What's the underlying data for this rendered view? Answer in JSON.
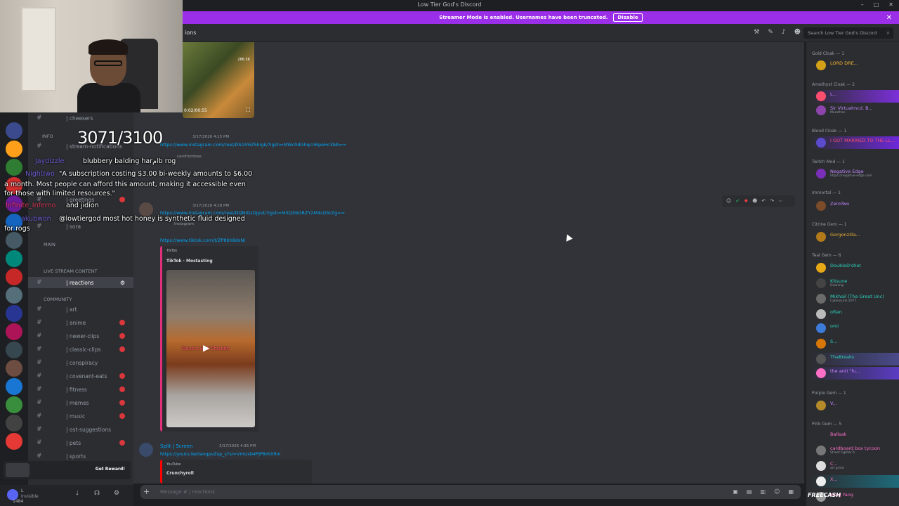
{
  "window": {
    "title": "Low Tier God's Discord"
  },
  "banner": {
    "text": "Streamer Mode is enabled. Usernames have been truncated.",
    "disable_label": "Disable",
    "close": "✕"
  },
  "header": {
    "channel_name": "ions",
    "search_placeholder": "Search Low Tier God's Discord",
    "icons": [
      "hammer-icon",
      "pin-icon",
      "bell-icon",
      "members-icon"
    ]
  },
  "stream_overlay": {
    "counter": "3071/3100",
    "chat": [
      {
        "user": "Jaydizzle",
        "text": "blubbery balding harامb rog"
      },
      {
        "user": "NightIwo",
        "text": "\"A subscription costing $3.00 bi-weekly amounts to $6.00"
      },
      {
        "user": "",
        "text": "a month. Most people can afford this amount, making it accessible even"
      },
      {
        "user": "",
        "text": "for those with limited resources.\""
      },
      {
        "user": "Infinite_Inferno",
        "text": "and jidion"
      },
      {
        "user": "akubwon",
        "text": "@lowtiergod most hot honey is synthetic fluid designed"
      },
      {
        "user": "",
        "text": "for rogs"
      }
    ]
  },
  "sidebar": {
    "channels": [
      {
        "label": "| cheesers",
        "unread": false
      },
      {
        "label": "| stream-notifications",
        "unread": false
      },
      {
        "label": "| greetings",
        "unread": true
      },
      {
        "label": "| sora",
        "unread": false
      },
      {
        "label": "| reactions",
        "unread": false,
        "active": true
      },
      {
        "label": "| art",
        "unread": false
      },
      {
        "label": "| anime",
        "unread": true
      },
      {
        "label": "| newer-clips",
        "unread": true
      },
      {
        "label": "| classic-clips",
        "unread": true
      },
      {
        "label": "| conspiracy",
        "unread": false
      },
      {
        "label": "| covenant-eats",
        "unread": true
      },
      {
        "label": "| fitness",
        "unread": true
      },
      {
        "label": "| memes",
        "unread": true
      },
      {
        "label": "| music",
        "unread": true
      },
      {
        "label": "| ost-suggestions",
        "unread": false
      },
      {
        "label": "| pets",
        "unread": true
      },
      {
        "label": "| sports",
        "unread": false
      }
    ],
    "categories": {
      "info": "INFO",
      "main": "MAIN",
      "live": "LIVE STREAM CONTENT",
      "community": "COMMUNITY"
    },
    "reward_label": "Get Reward!",
    "user_panel": {
      "name": "L",
      "status": "Invisible",
      "id": "1484"
    }
  },
  "messages": {
    "m1": {
      "timestamp": "3/17/2026 4:15 PM",
      "link": "https://www.instagram.com/reel/DSGV6Z5kigk/?igsh=MWc0dGhqcnRpeHc3bA==",
      "embed_user": "camfromboe",
      "likes": "286.5K",
      "time": "0:02/00:55"
    },
    "m2": {
      "timestamp": "3/17/2026 4:28 PM",
      "link": "https://www.instagram.com/reel/DQNIGzOjpvl/?igsh=MXQ5bGRZY2M4cG5rZg==",
      "embed_label": "Instagram"
    },
    "m3": {
      "link": "https://www.tiktok.com/t/ZP8bh8dsN/",
      "provider": "TikTok",
      "title": "TikTok · Mostasting",
      "video_caption": "Dave's Hot Chicken"
    },
    "m4": {
      "author": "Split | Screen",
      "timestamp": "3/17/2026 4:36 PM",
      "link": "https://youtu.be/lanqpvZsp_s?si=VmUsb4PJP8rKXlhn",
      "provider": "YouTube",
      "title": "Crunchyroll"
    }
  },
  "composer": {
    "placeholder": "Message # | reactions"
  },
  "members": {
    "roles": [
      {
        "label": "Gold Cloak — 1"
      },
      {
        "label": "Amethyst Cloak — 2"
      },
      {
        "label": "Blood Cloak — 1"
      },
      {
        "label": "Twitch Mod — 1"
      },
      {
        "label": "Immortal — 1"
      },
      {
        "label": "Citrine Gem — 1"
      },
      {
        "label": "Teal Gem — 6"
      },
      {
        "label": "Purple Gem — 1"
      },
      {
        "label": "Pink Gem — 5"
      }
    ],
    "list": [
      {
        "name": "LORD DRE...",
        "sub": "",
        "color": "#f0b232"
      },
      {
        "name": "L...",
        "sub": "",
        "color": "#c586ff"
      },
      {
        "name": "Sir Virtualmcd. B...",
        "sub": "Marathon",
        "color": "#c586ff"
      },
      {
        "name": "I GOT MARRIED TO THE LL...",
        "sub": "",
        "color": "#ff4d6d"
      },
      {
        "name": "Negative Edge",
        "sub": "https://negative-edge.com",
        "color": "#c586ff"
      },
      {
        "name": "ZeroTwo",
        "sub": "",
        "color": "#c586ff"
      },
      {
        "name": "Gorgonzilla...",
        "sub": "",
        "color": "#f0b232"
      },
      {
        "name": "DoubleD'shot",
        "sub": "",
        "color": "#2dd4bf"
      },
      {
        "name": "Kitsune",
        "sub": "Gooning",
        "color": "#2dd4bf"
      },
      {
        "name": "Mikhail (The Great Unc)",
        "sub": "Cyberpunk 2077",
        "color": "#2dd4bf"
      },
      {
        "name": "often",
        "sub": "",
        "color": "#2dd4bf"
      },
      {
        "name": "omi",
        "sub": "",
        "color": "#2dd4bf"
      },
      {
        "name": "S...",
        "sub": "",
        "color": "#2dd4bf"
      },
      {
        "name": "ThaBreaks",
        "sub": "",
        "color": "#2dd4bf"
      },
      {
        "name": "the anti \"fu...",
        "sub": "",
        "color": "#c586ff"
      },
      {
        "name": "V...",
        "sub": "",
        "color": "#c586ff"
      },
      {
        "name": "Ballsak",
        "sub": "",
        "color": "#ff6ec7"
      },
      {
        "name": "cardboard box tycoon",
        "sub": "Street Fighter 6",
        "color": "#ff6ec7"
      },
      {
        "name": "C...",
        "sub": "art grind",
        "color": "#ff6ec7"
      },
      {
        "name": "X...",
        "sub": "",
        "color": "#ff6ec7"
      },
      {
        "name": "Yung Yang",
        "sub": "",
        "color": "#ff6ec7"
      }
    ]
  },
  "watermark": "FREECASH"
}
